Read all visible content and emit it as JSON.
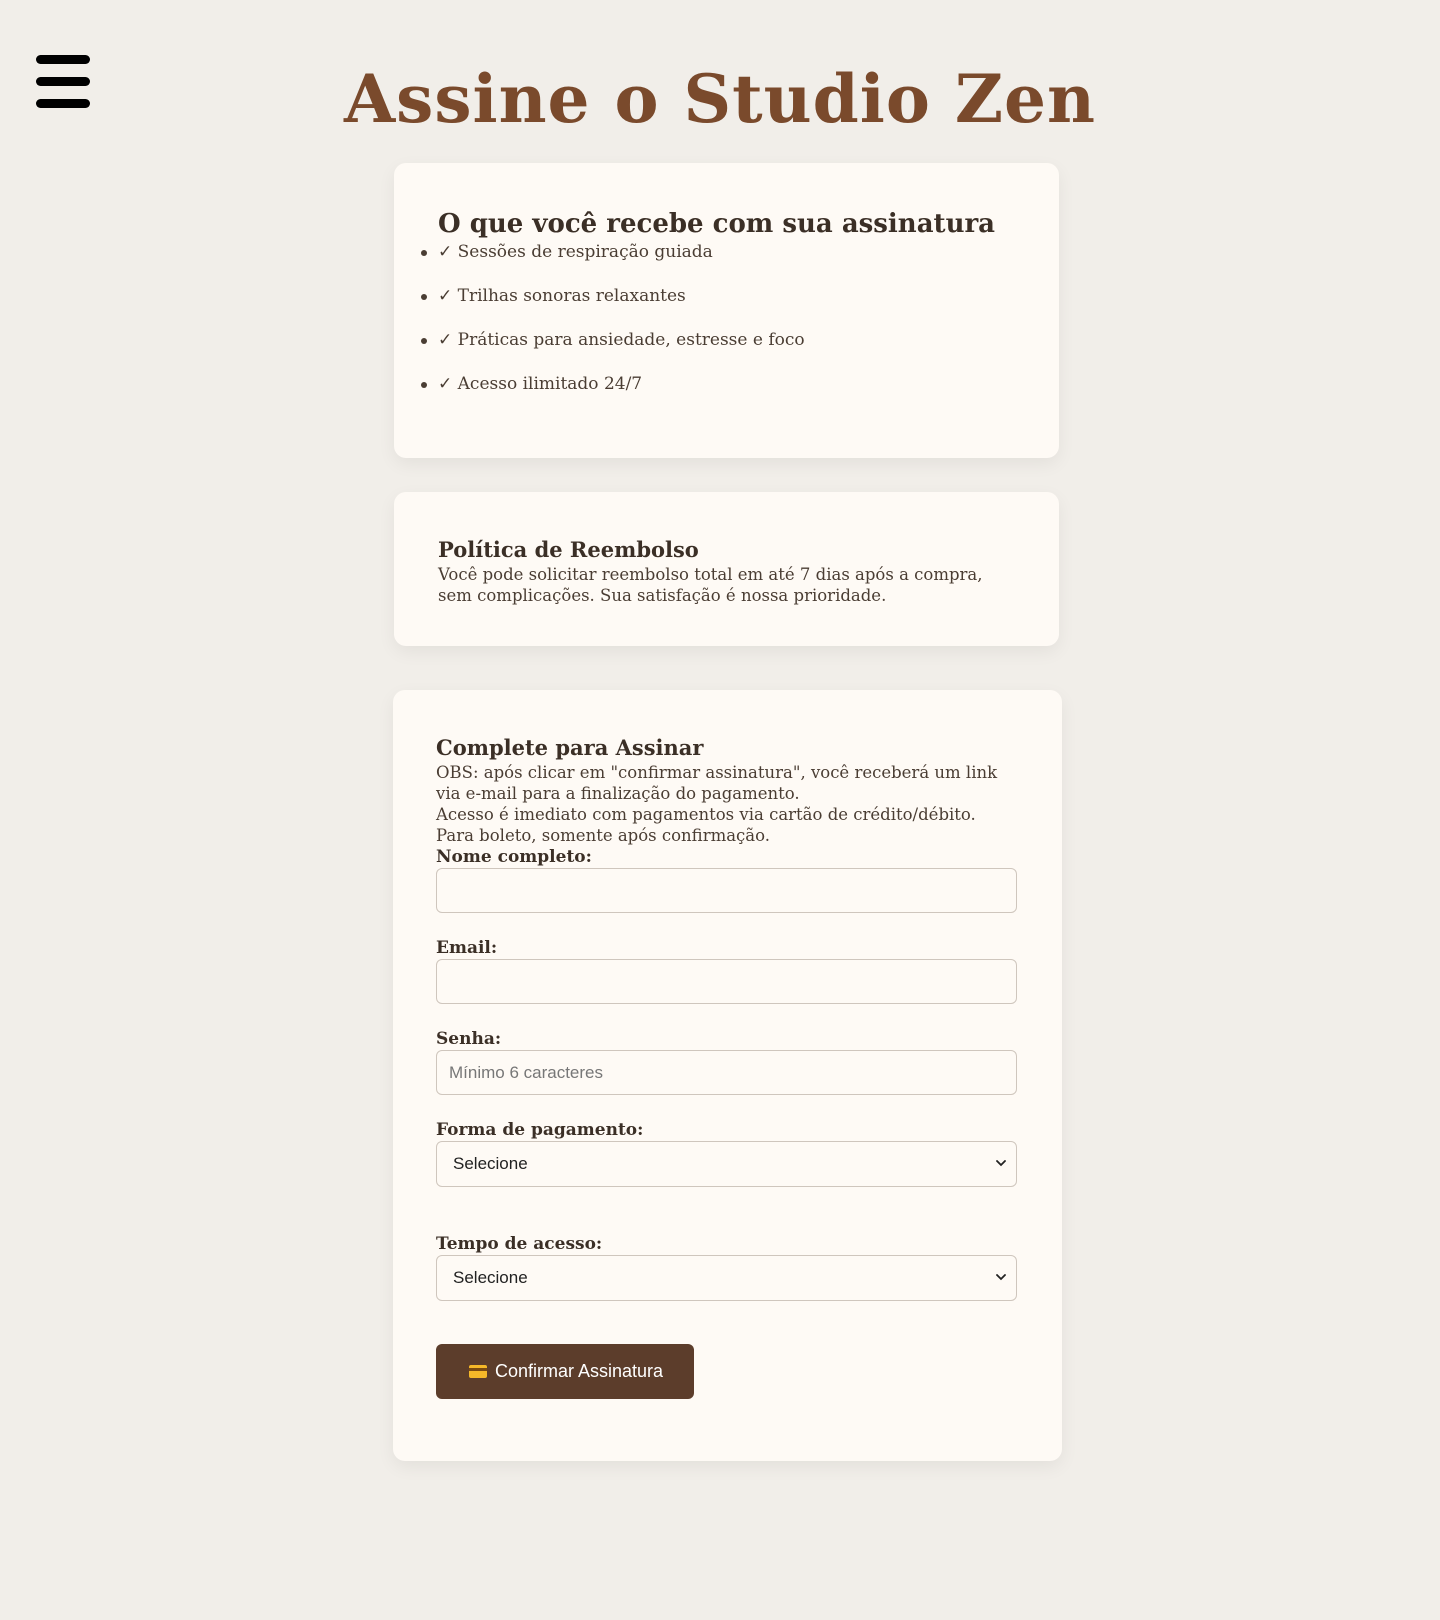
{
  "header": {
    "title": "Assine o Studio Zen"
  },
  "benefits": {
    "heading": "O que você recebe com sua assinatura",
    "items": [
      "✓ Sessões de respiração guiada",
      "✓ Trilhas sonoras relaxantes",
      "✓ Práticas para ansiedade, estresse e foco",
      "✓ Acesso ilimitado 24/7"
    ]
  },
  "refund": {
    "heading": "Política de Reembolso",
    "text": "Você pode solicitar reembolso total em até 7 dias após a compra, sem complicações. Sua satisfação é nossa prioridade."
  },
  "form": {
    "heading": "Complete para Assinar",
    "note_1": "OBS: após clicar em \"confirmar assinatura\", você receberá um link via e-mail para a finalização do pagamento.",
    "note_2": "Acesso é imediato com pagamentos via cartão de crédito/débito. Para boleto, somente após confirmação.",
    "name_label": "Nome completo:",
    "name_value": "",
    "email_label": "Email:",
    "email_value": "",
    "password_label": "Senha:",
    "password_placeholder": "Mínimo 6 caracteres",
    "payment_label": "Forma de pagamento:",
    "payment_selected": "Selecione",
    "duration_label": "Tempo de acesso:",
    "duration_selected": "Selecione",
    "submit_label": "Confirmar Assinatura",
    "submit_icon": "credit-card-icon"
  },
  "colors": {
    "background": "#f1eee9",
    "card": "#fefaf5",
    "title": "#7a4a2c",
    "button": "#5c3d2b"
  }
}
